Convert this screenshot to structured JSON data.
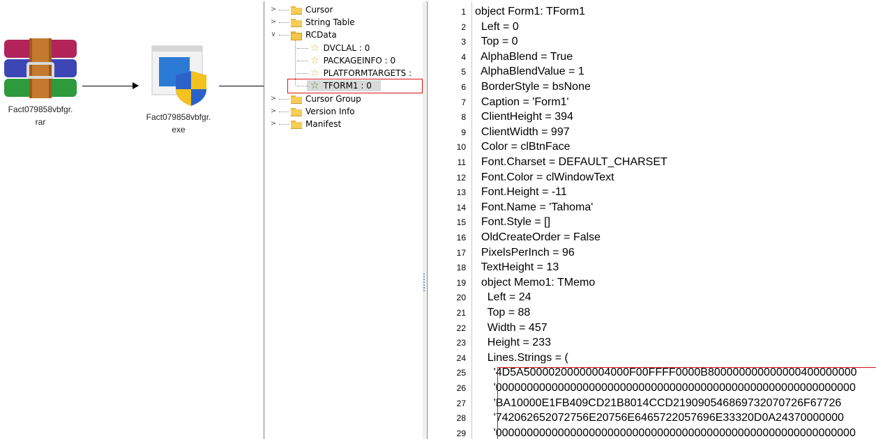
{
  "files": {
    "rar": {
      "line1": "Fact079858vbfgr.",
      "line2": "rar",
      "icon": "winrar-archive-icon"
    },
    "exe": {
      "line1": "Fact079858vbfgr.",
      "line2": "exe",
      "icon": "exe-shield-icon"
    }
  },
  "tree": {
    "items": [
      {
        "label": "Cursor"
      },
      {
        "label": "String Table"
      },
      {
        "label": "RCData"
      },
      {
        "label": "DVCLAL : 0"
      },
      {
        "label": "PACKAGEINFO : 0"
      },
      {
        "label": "PLATFORMTARGETS :"
      },
      {
        "label": "TFORM1 : 0"
      },
      {
        "label": "Cursor Group"
      },
      {
        "label": "Version Info"
      },
      {
        "label": "Manifest"
      }
    ]
  },
  "code": {
    "lines": [
      "object Form1: TForm1",
      "  Left = 0",
      "  Top = 0",
      "  AlphaBlend = True",
      "  AlphaBlendValue = 1",
      "  BorderStyle = bsNone",
      "  Caption = 'Form1'",
      "  ClientHeight = 394",
      "  ClientWidth = 997",
      "  Color = clBtnFace",
      "  Font.Charset = DEFAULT_CHARSET",
      "  Font.Color = clWindowText",
      "  Font.Height = -11",
      "  Font.Name = 'Tahoma'",
      "  Font.Style = []",
      "  OldCreateOrder = False",
      "  PixelsPerInch = 96",
      "  TextHeight = 13",
      "  object Memo1: TMemo",
      "    Left = 24",
      "    Top = 88",
      "    Width = 457",
      "    Height = 233",
      "    Lines.Strings = (",
      "      '4D5A50000200000004000F00FFFF0000B800000000000000400000000",
      "      '0000000000000000000000000000000000000000000000000000000000",
      "      'BA10000E1FB409CD21B8014CCD219090546869732070726F67726",
      "      '742062652072756E20756E6465722057696E33320D0A24370000000",
      "      '0000000000000000000000000000000000000000000000000000000000"
    ],
    "numbers": [
      "1",
      "2",
      "3",
      "4",
      "5",
      "6",
      "7",
      "8",
      "9",
      "10",
      "11",
      "12",
      "13",
      "14",
      "15",
      "16",
      "17",
      "18",
      "19",
      "20",
      "21",
      "22",
      "23",
      "24",
      "25",
      "26",
      "27",
      "28",
      "29"
    ]
  },
  "colors": {
    "highlight_border": "#dd1111",
    "selection_bg": "#d9d9d9"
  }
}
